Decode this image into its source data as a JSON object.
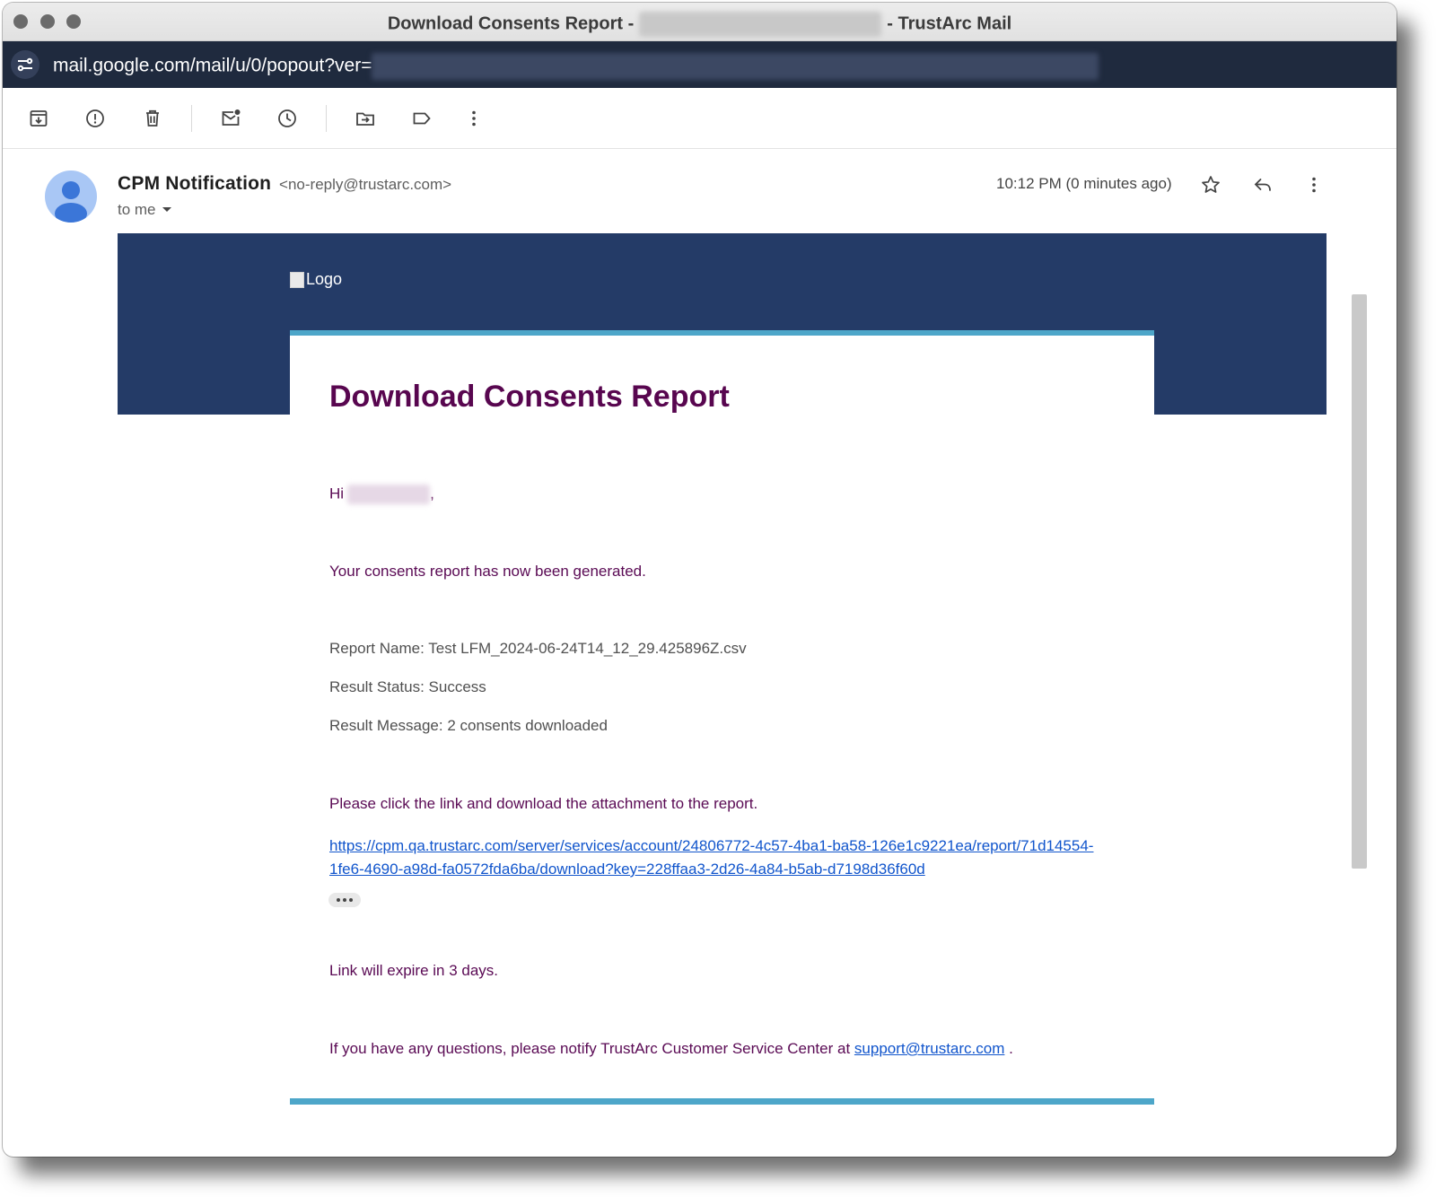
{
  "window": {
    "title_prefix": "Download Consents Report -",
    "title_suffix": "- TrustArc Mail"
  },
  "address_bar": {
    "url": "mail.google.com/mail/u/0/popout?ver="
  },
  "toolbar": {
    "icons": [
      "archive-icon",
      "report-spam-icon",
      "delete-icon",
      "mark-unread-icon",
      "snooze-icon",
      "move-to-icon",
      "label-icon",
      "more-vert-icon"
    ]
  },
  "message": {
    "sender_name": "CPM Notification",
    "sender_email": "<no-reply@trustarc.com>",
    "to": "to me",
    "time": "10:12 PM (0 minutes ago)"
  },
  "email": {
    "logo_alt": "Logo",
    "heading": "Download Consents Report",
    "greeting": "Hi",
    "greeting_end": ",",
    "generated": "Your consents report has now been generated.",
    "report_name": "Report Name: Test LFM_2024-06-24T14_12_29.425896Z.csv",
    "result_status": "Result Status: Success",
    "result_message": "Result Message: 2 consents downloaded",
    "click_instruction": "Please click the link and download the attachment to the report.",
    "link_line1": "https://cpm.qa.trustarc.com/server/services/account/24806772-4c57-4ba1-ba58-126e1c9221ea/report/71d14554-",
    "link_line2": "1fe6-4690-a98d-fa0572fda6ba/download?key=228ffaa3-2d26-4a84-b5ab-d7198d36f60d",
    "expire": "Link will expire in 3 days.",
    "questions": "If you have any questions, please notify TrustArc Customer Service Center at",
    "support_email": "support@trustarc.com",
    "questions_end": "."
  },
  "colors": {
    "banner": "#243b67",
    "accent_bar": "#4da6c9",
    "heading": "#58064f",
    "link": "#1155cc"
  }
}
